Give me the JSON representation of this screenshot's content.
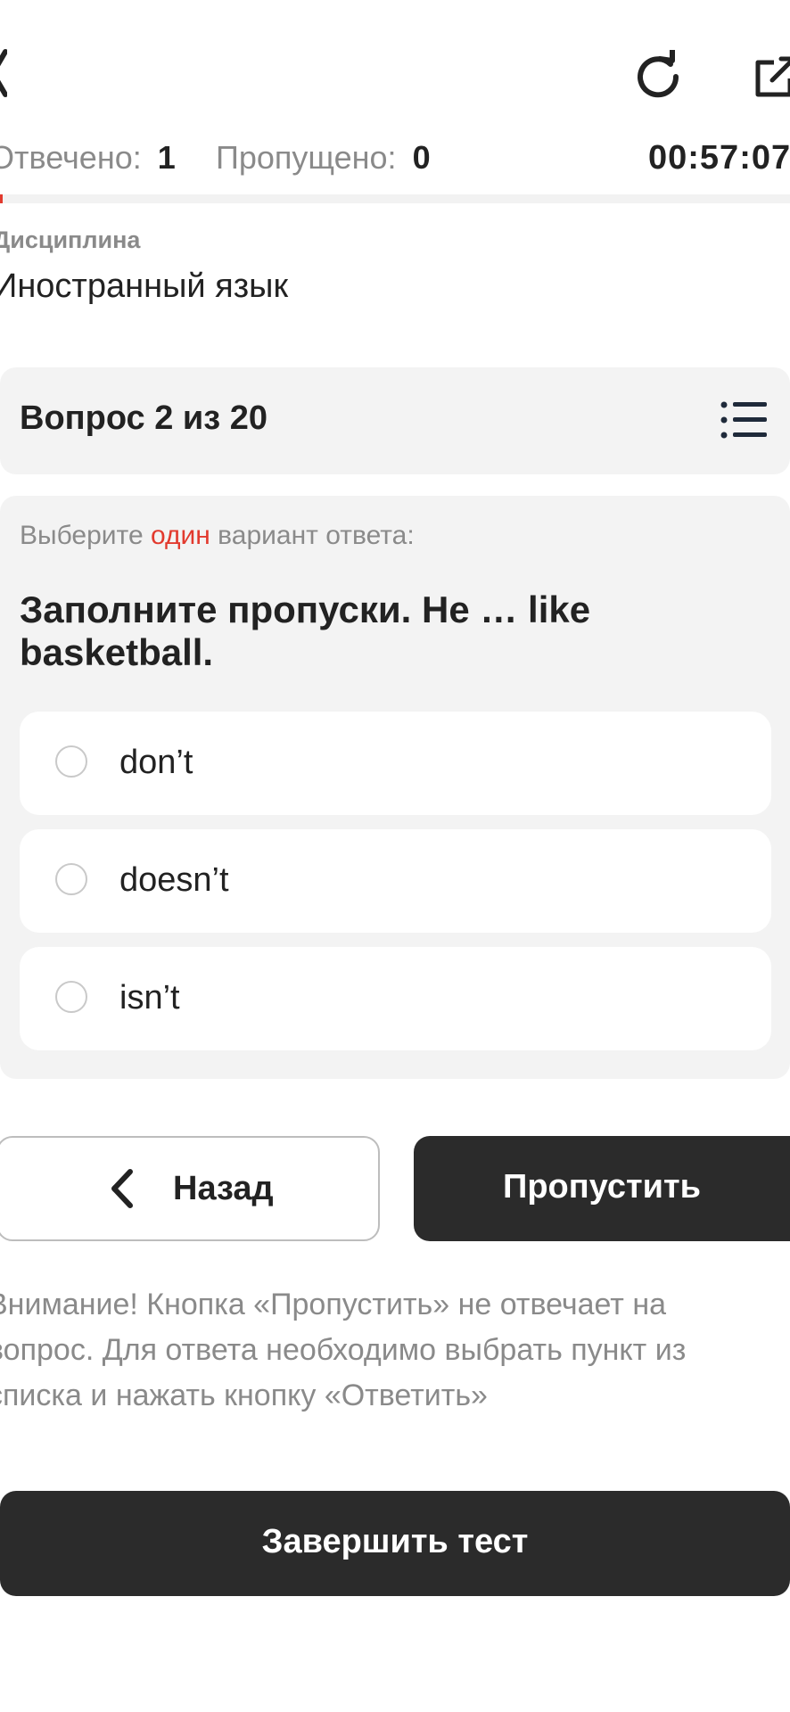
{
  "header": {
    "back_icon": "chevron-left-icon",
    "reload_icon": "reload-icon",
    "external_icon": "external-link-icon"
  },
  "status": {
    "answered_label": "Отвечено:",
    "answered_value": "1",
    "skipped_label": "Пропущено:",
    "skipped_value": "0",
    "timer": "00:57:07"
  },
  "discipline": {
    "label": "Дисциплина",
    "value": "Иностранный язык"
  },
  "question": {
    "counter": "Вопрос 2 из 20",
    "list_icon": "list-icon",
    "instruction_prefix": "Выберите ",
    "instruction_accent": "один",
    "instruction_suffix": " вариант ответа:",
    "text": "Заполните пропуски. He … like basketball.",
    "options": [
      {
        "label": "don’t"
      },
      {
        "label": "doesn’t"
      },
      {
        "label": "isn’t"
      }
    ]
  },
  "nav": {
    "back_label": "Назад",
    "skip_label": "Пропустить"
  },
  "warning": "Внимание! Кнопка «Пропустить» не отвечает на вопрос. Для ответа необходимо выбрать пункт из списка и нажать кнопку «Ответить»",
  "finish_label": "Завершить тест",
  "colors": {
    "accent": "#e23a2e",
    "dark_button": "#2b2b2b",
    "card_bg": "#f3f3f3",
    "muted_text": "#8a8a8a"
  }
}
